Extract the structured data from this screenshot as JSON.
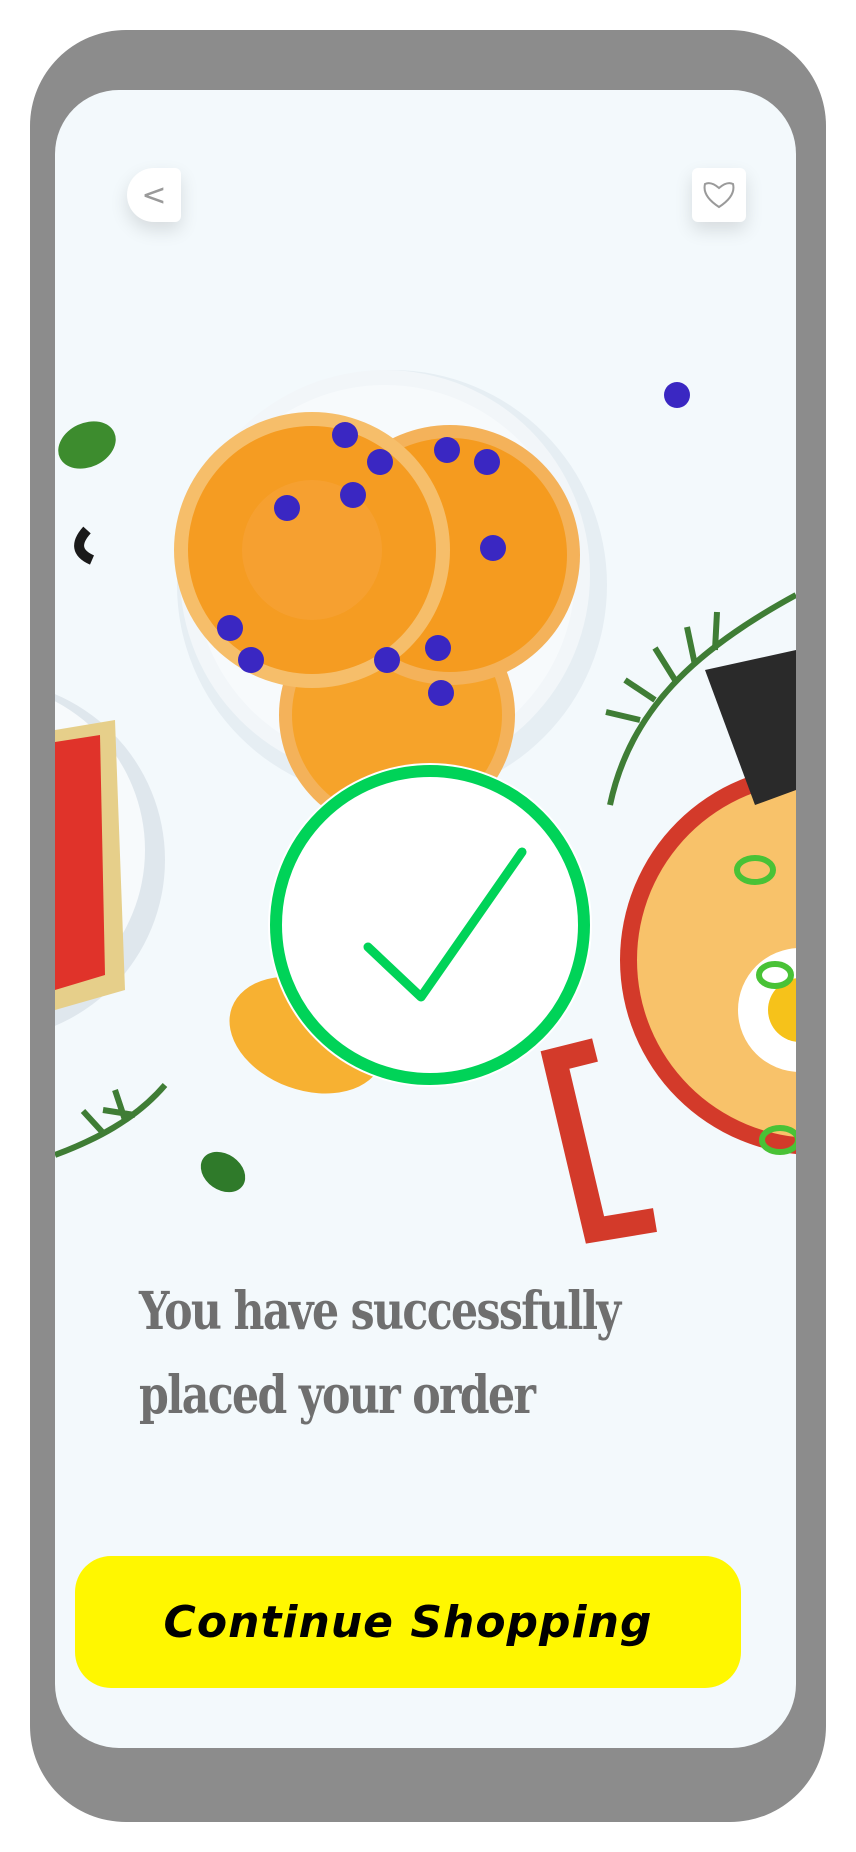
{
  "screen": {
    "back_button": {
      "icon": "chevron-left-icon",
      "glyph": "<"
    },
    "favorite_button": {
      "icon": "heart-outline-icon"
    },
    "illustration": {
      "icon": "checkmark-circle-icon",
      "accent_color": "#00d358"
    },
    "message": "You have successfully placed your order",
    "continue_button": {
      "label": "Continue Shopping",
      "color": "#fff700"
    }
  }
}
